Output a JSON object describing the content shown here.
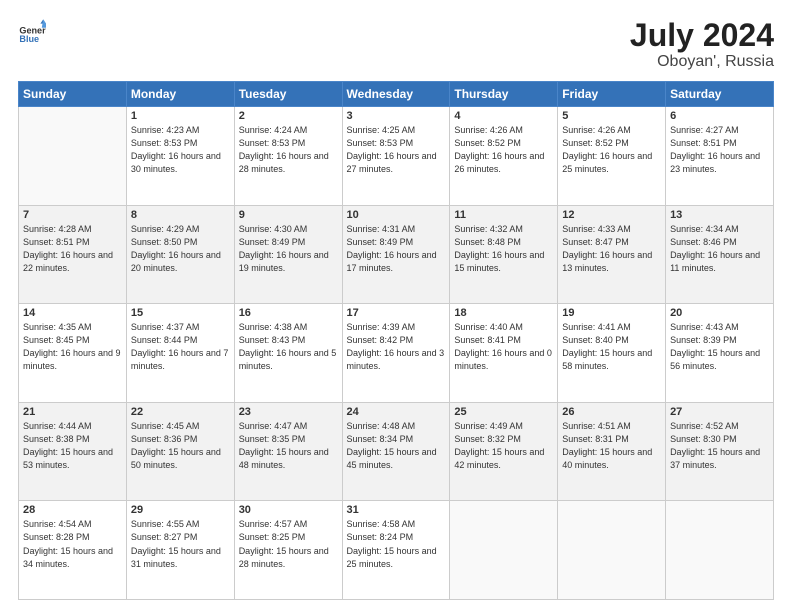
{
  "header": {
    "logo_line1": "General",
    "logo_line2": "Blue",
    "month_year": "July 2024",
    "location": "Oboyan', Russia"
  },
  "days_of_week": [
    "Sunday",
    "Monday",
    "Tuesday",
    "Wednesday",
    "Thursday",
    "Friday",
    "Saturday"
  ],
  "weeks": [
    [
      {
        "day": null
      },
      {
        "day": "1",
        "sunrise": "4:23 AM",
        "sunset": "8:53 PM",
        "daylight": "16 hours and 30 minutes."
      },
      {
        "day": "2",
        "sunrise": "4:24 AM",
        "sunset": "8:53 PM",
        "daylight": "16 hours and 28 minutes."
      },
      {
        "day": "3",
        "sunrise": "4:25 AM",
        "sunset": "8:53 PM",
        "daylight": "16 hours and 27 minutes."
      },
      {
        "day": "4",
        "sunrise": "4:26 AM",
        "sunset": "8:52 PM",
        "daylight": "16 hours and 26 minutes."
      },
      {
        "day": "5",
        "sunrise": "4:26 AM",
        "sunset": "8:52 PM",
        "daylight": "16 hours and 25 minutes."
      },
      {
        "day": "6",
        "sunrise": "4:27 AM",
        "sunset": "8:51 PM",
        "daylight": "16 hours and 23 minutes."
      }
    ],
    [
      {
        "day": "7",
        "sunrise": "4:28 AM",
        "sunset": "8:51 PM",
        "daylight": "16 hours and 22 minutes."
      },
      {
        "day": "8",
        "sunrise": "4:29 AM",
        "sunset": "8:50 PM",
        "daylight": "16 hours and 20 minutes."
      },
      {
        "day": "9",
        "sunrise": "4:30 AM",
        "sunset": "8:49 PM",
        "daylight": "16 hours and 19 minutes."
      },
      {
        "day": "10",
        "sunrise": "4:31 AM",
        "sunset": "8:49 PM",
        "daylight": "16 hours and 17 minutes."
      },
      {
        "day": "11",
        "sunrise": "4:32 AM",
        "sunset": "8:48 PM",
        "daylight": "16 hours and 15 minutes."
      },
      {
        "day": "12",
        "sunrise": "4:33 AM",
        "sunset": "8:47 PM",
        "daylight": "16 hours and 13 minutes."
      },
      {
        "day": "13",
        "sunrise": "4:34 AM",
        "sunset": "8:46 PM",
        "daylight": "16 hours and 11 minutes."
      }
    ],
    [
      {
        "day": "14",
        "sunrise": "4:35 AM",
        "sunset": "8:45 PM",
        "daylight": "16 hours and 9 minutes."
      },
      {
        "day": "15",
        "sunrise": "4:37 AM",
        "sunset": "8:44 PM",
        "daylight": "16 hours and 7 minutes."
      },
      {
        "day": "16",
        "sunrise": "4:38 AM",
        "sunset": "8:43 PM",
        "daylight": "16 hours and 5 minutes."
      },
      {
        "day": "17",
        "sunrise": "4:39 AM",
        "sunset": "8:42 PM",
        "daylight": "16 hours and 3 minutes."
      },
      {
        "day": "18",
        "sunrise": "4:40 AM",
        "sunset": "8:41 PM",
        "daylight": "16 hours and 0 minutes."
      },
      {
        "day": "19",
        "sunrise": "4:41 AM",
        "sunset": "8:40 PM",
        "daylight": "15 hours and 58 minutes."
      },
      {
        "day": "20",
        "sunrise": "4:43 AM",
        "sunset": "8:39 PM",
        "daylight": "15 hours and 56 minutes."
      }
    ],
    [
      {
        "day": "21",
        "sunrise": "4:44 AM",
        "sunset": "8:38 PM",
        "daylight": "15 hours and 53 minutes."
      },
      {
        "day": "22",
        "sunrise": "4:45 AM",
        "sunset": "8:36 PM",
        "daylight": "15 hours and 50 minutes."
      },
      {
        "day": "23",
        "sunrise": "4:47 AM",
        "sunset": "8:35 PM",
        "daylight": "15 hours and 48 minutes."
      },
      {
        "day": "24",
        "sunrise": "4:48 AM",
        "sunset": "8:34 PM",
        "daylight": "15 hours and 45 minutes."
      },
      {
        "day": "25",
        "sunrise": "4:49 AM",
        "sunset": "8:32 PM",
        "daylight": "15 hours and 42 minutes."
      },
      {
        "day": "26",
        "sunrise": "4:51 AM",
        "sunset": "8:31 PM",
        "daylight": "15 hours and 40 minutes."
      },
      {
        "day": "27",
        "sunrise": "4:52 AM",
        "sunset": "8:30 PM",
        "daylight": "15 hours and 37 minutes."
      }
    ],
    [
      {
        "day": "28",
        "sunrise": "4:54 AM",
        "sunset": "8:28 PM",
        "daylight": "15 hours and 34 minutes."
      },
      {
        "day": "29",
        "sunrise": "4:55 AM",
        "sunset": "8:27 PM",
        "daylight": "15 hours and 31 minutes."
      },
      {
        "day": "30",
        "sunrise": "4:57 AM",
        "sunset": "8:25 PM",
        "daylight": "15 hours and 28 minutes."
      },
      {
        "day": "31",
        "sunrise": "4:58 AM",
        "sunset": "8:24 PM",
        "daylight": "15 hours and 25 minutes."
      },
      {
        "day": null
      },
      {
        "day": null
      },
      {
        "day": null
      }
    ]
  ]
}
